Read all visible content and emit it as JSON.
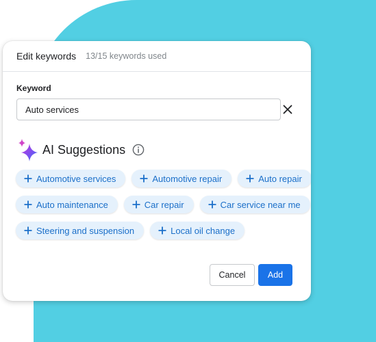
{
  "dialog": {
    "title": "Edit keywords",
    "usage": "13/15 keywords used"
  },
  "keyword": {
    "label": "Keyword",
    "value": "Auto services",
    "clear_icon": "close-icon"
  },
  "ai": {
    "icon": "sparkle-icon",
    "title": "AI Suggestions",
    "info_icon": "info-icon"
  },
  "suggestions": [
    [
      "Automotive services",
      "Automotive repair",
      "Auto repair"
    ],
    [
      "Auto maintenance",
      "Car repair",
      "Car service near me"
    ],
    [
      "Steering and suspension",
      "Local oil change"
    ]
  ],
  "actions": {
    "cancel": "Cancel",
    "add": "Add"
  },
  "colors": {
    "background_shape": "#52cfe3",
    "accent": "#1a73e8",
    "chip_background": "#e5f1fc"
  }
}
